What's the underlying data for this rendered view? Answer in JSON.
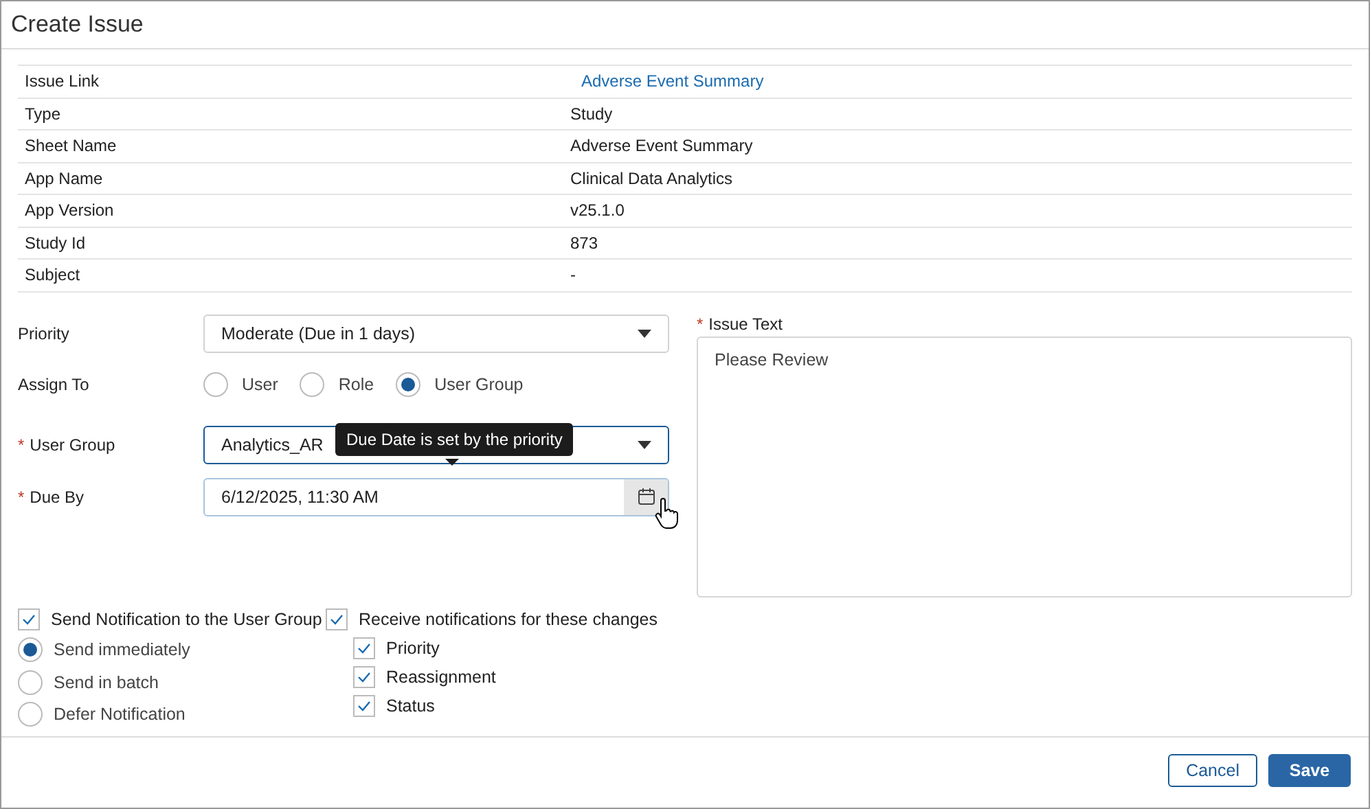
{
  "window": {
    "title": "Create Issue"
  },
  "details": [
    {
      "label": "Issue Link",
      "value": "Adverse Event Summary",
      "kind": "link"
    },
    {
      "label": "Type",
      "value": "Study",
      "kind": "text"
    },
    {
      "label": "Sheet Name",
      "value": "Adverse Event Summary",
      "kind": "text"
    },
    {
      "label": "App Name",
      "value": "Clinical Data Analytics",
      "kind": "text"
    },
    {
      "label": "App Version",
      "value": "v25.1.0",
      "kind": "text"
    },
    {
      "label": "Study Id",
      "value": "873",
      "kind": "text"
    },
    {
      "label": "Subject",
      "value": "-",
      "kind": "text"
    }
  ],
  "priority": {
    "label": "Priority",
    "value": "Moderate (Due in 1 days)"
  },
  "assign_to": {
    "label": "Assign To",
    "options": [
      {
        "label": "User",
        "selected": false
      },
      {
        "label": "Role",
        "selected": false
      },
      {
        "label": "User Group",
        "selected": true
      }
    ]
  },
  "user_group": {
    "required_mark": "*",
    "label": "User Group",
    "value": "Analytics_AR",
    "focused": true
  },
  "due_by": {
    "required_mark": "*",
    "label": "Due By",
    "value": "6/12/2025, 11:30 AM",
    "tooltip": "Due Date is set by the priority"
  },
  "issue_text": {
    "required_mark": "*",
    "label": "Issue Text",
    "value": "Please Review"
  },
  "send_notification": {
    "label": "Send Notification to the User Group",
    "checked": true,
    "options": [
      {
        "label": "Send immediately",
        "selected": true
      },
      {
        "label": "Send in batch",
        "selected": false
      },
      {
        "label": "Defer Notification",
        "selected": false
      }
    ]
  },
  "receive_notifications": {
    "label": "Receive notifications for these changes",
    "checked": true,
    "items": [
      {
        "label": "Priority",
        "checked": true
      },
      {
        "label": "Reassignment",
        "checked": true
      },
      {
        "label": "Status",
        "checked": true
      }
    ]
  },
  "buttons": [
    {
      "label": "Cancel",
      "kind": "secondary"
    },
    {
      "label": "Save",
      "kind": "primary"
    }
  ]
}
